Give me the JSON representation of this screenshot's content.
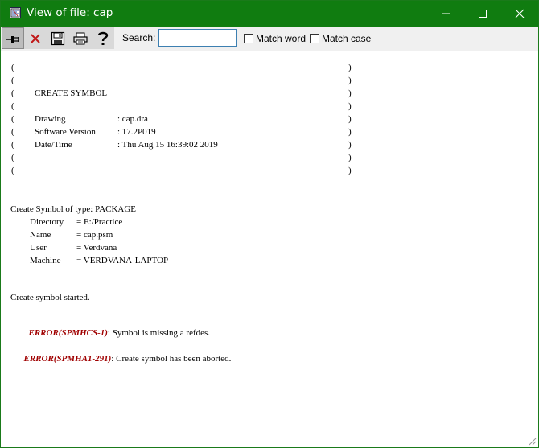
{
  "window": {
    "title": "View of file: cap",
    "accent": "#107c10"
  },
  "toolbar": {
    "buttons": [
      {
        "name": "pin-icon"
      },
      {
        "name": "close-x-icon"
      },
      {
        "name": "save-icon"
      },
      {
        "name": "print-icon"
      },
      {
        "name": "help-icon"
      }
    ],
    "search_label": "Search:",
    "search_value": "",
    "match_word": "Match word",
    "match_case": "Match case"
  },
  "log": {
    "box_title": "CREATE SYMBOL",
    "box_rows": [
      {
        "key": "Drawing",
        "value": ": cap.dra"
      },
      {
        "key": "Software Version",
        "value": ": 17.2P019"
      },
      {
        "key": "Date/Time",
        "value": ": Thu Aug 15 16:39:02 2019"
      }
    ],
    "box_border_char": "(",
    "box_border_char_right": ")",
    "create_line": "Create Symbol of type: PACKAGE",
    "props": [
      {
        "key": "Directory",
        "value": "= E:/Practice"
      },
      {
        "key": "Name",
        "value": "= cap.psm"
      },
      {
        "key": "User",
        "value": "= Verdvana"
      },
      {
        "key": "Machine",
        "value": "= VERDVANA-LAPTOP"
      }
    ],
    "started": "Create symbol started.",
    "errors": [
      {
        "code": "ERROR(SPMHCS-1)",
        "message": ": Symbol is missing a refdes."
      },
      {
        "code": "ERROR(SPMHA1-291)",
        "message": ": Create symbol has been aborted."
      }
    ],
    "error_color": "#a00000"
  }
}
